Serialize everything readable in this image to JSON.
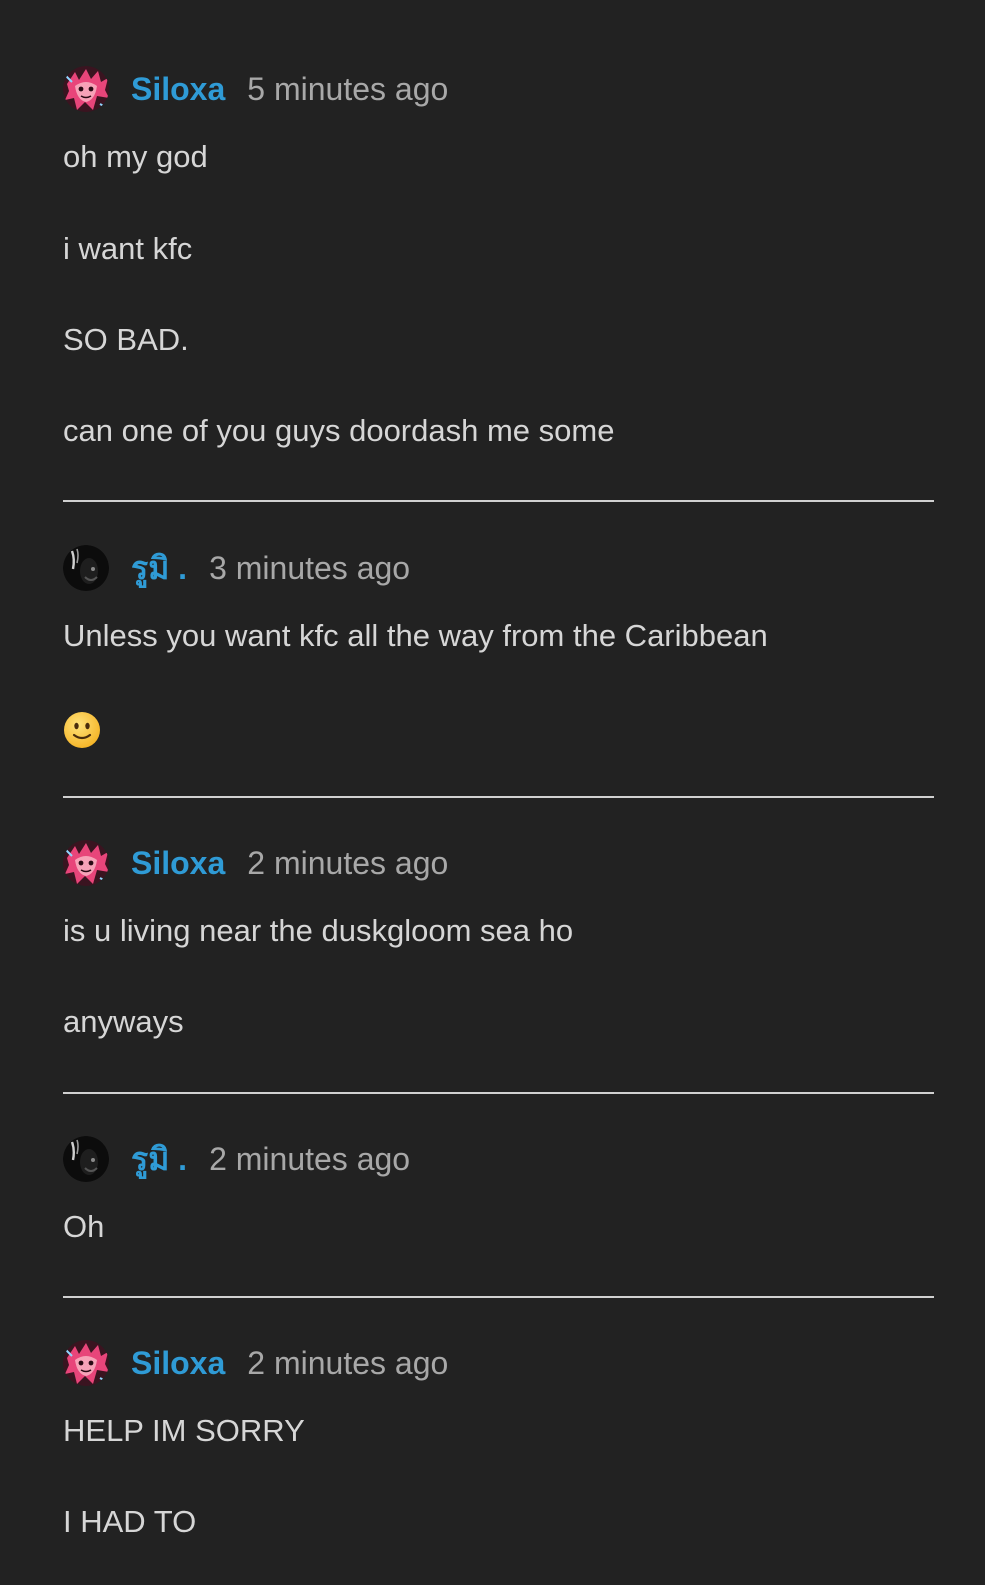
{
  "theme": {
    "background": "#222222",
    "text": "#d6d6d6",
    "username_color": "#2f9bd6",
    "timestamp_color": "#a8a8a8",
    "divider_color": "#d0d0d0"
  },
  "comments": [
    {
      "author": "Siloxa",
      "avatar_icon": "siloxa-avatar",
      "time": "5 minutes ago",
      "paragraphs": [
        "oh my god",
        "i want kfc",
        "SO BAD.",
        "can one of you guys doordash me some"
      ]
    },
    {
      "author": "รูมิ .",
      "avatar_icon": "rumi-avatar",
      "time": "3 minutes ago",
      "paragraphs": [
        "Unless you want kfc all the way from the Caribbean"
      ],
      "emoji": "slightly-smiling-face-icon"
    },
    {
      "author": "Siloxa",
      "avatar_icon": "siloxa-avatar",
      "time": "2 minutes ago",
      "paragraphs": [
        "is u living near the duskgloom sea ho",
        "anyways"
      ]
    },
    {
      "author": "รูมิ .",
      "avatar_icon": "rumi-avatar",
      "time": "2 minutes ago",
      "paragraphs": [
        "Oh"
      ]
    },
    {
      "author": "Siloxa",
      "avatar_icon": "siloxa-avatar",
      "time": "2 minutes ago",
      "paragraphs": [
        "HELP IM SORRY",
        "I HAD TO"
      ]
    }
  ]
}
